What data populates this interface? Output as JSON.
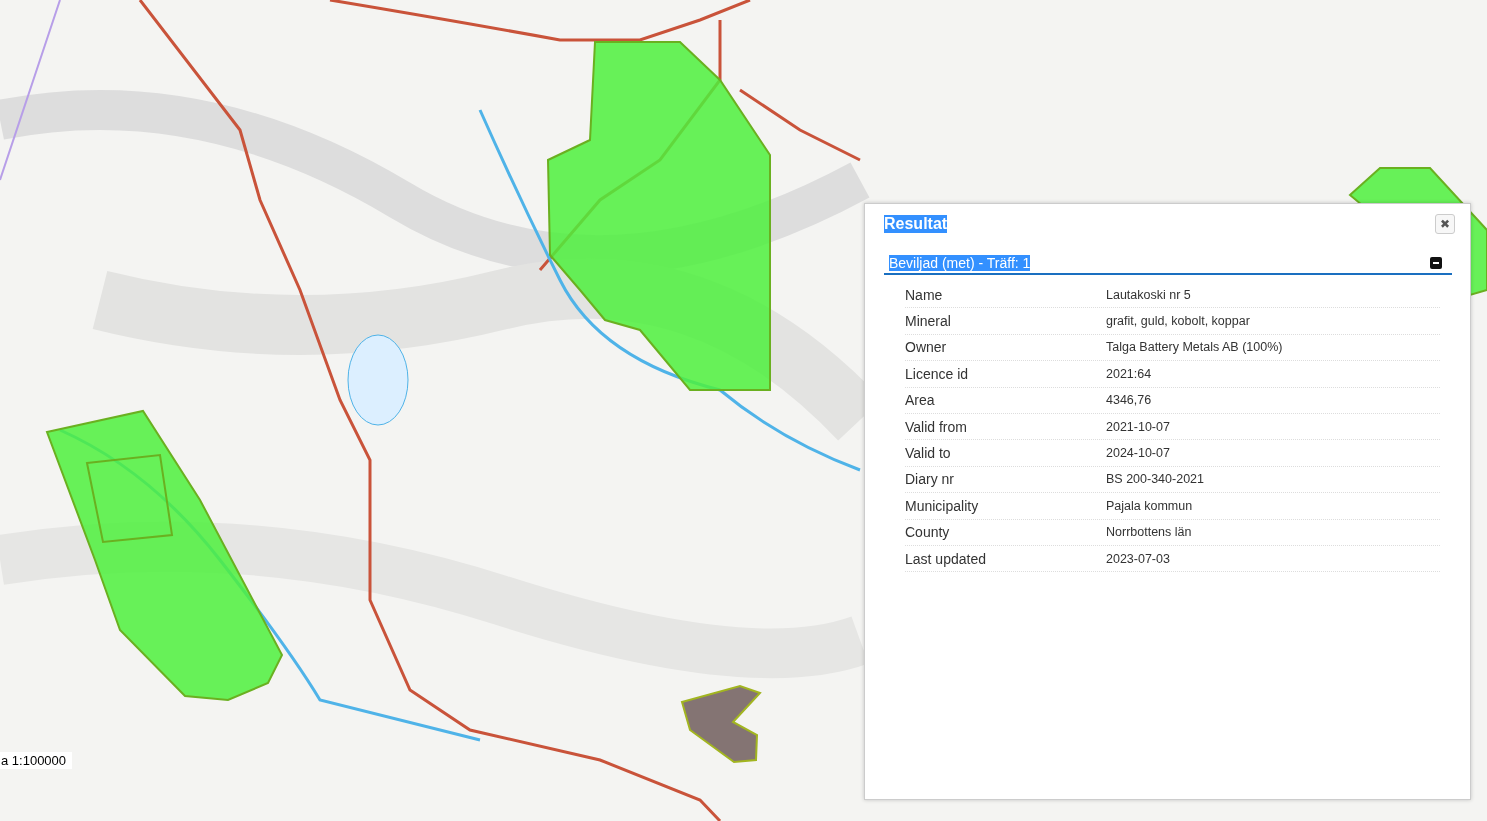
{
  "map": {
    "scale": "a 1:100000"
  },
  "results": {
    "title": "Resultat",
    "close_icon": "✖",
    "section": {
      "header": "Beviljad (met) - Träff: 1",
      "expanded": true,
      "rows": [
        {
          "label": "Name",
          "value": "Lautakoski nr 5"
        },
        {
          "label": "Mineral",
          "value": "grafit, guld, kobolt, koppar"
        },
        {
          "label": "Owner",
          "value": "Talga Battery Metals AB (100%)"
        },
        {
          "label": "Licence id",
          "value": "2021:64"
        },
        {
          "label": "Area",
          "value": "4346,76"
        },
        {
          "label": "Valid from",
          "value": "2021-10-07"
        },
        {
          "label": "Valid to",
          "value": "2024-10-07"
        },
        {
          "label": "Diary nr",
          "value": "BS 200-340-2021"
        },
        {
          "label": "Municipality",
          "value": "Pajala kommun"
        },
        {
          "label": "County",
          "value": "Norrbottens län"
        },
        {
          "label": "Last updated",
          "value": "2023-07-03"
        }
      ]
    }
  }
}
